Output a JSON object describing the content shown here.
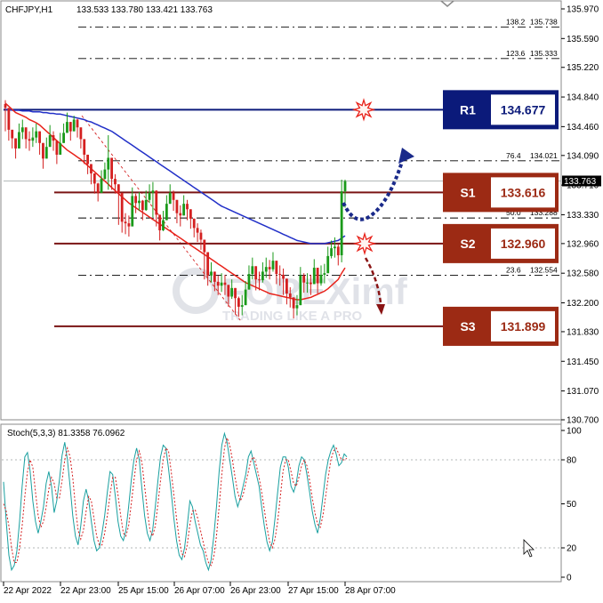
{
  "header": {
    "symbol": "CHFJPY,H1",
    "ohlc": "133.533 133.780 133.421 133.763"
  },
  "watermark": {
    "brand": "FOREXimf",
    "tagline": "TRADING LIKE A PRO"
  },
  "colors": {
    "bull": "#1a9a1a",
    "bear": "#d42020",
    "ma_fast": "#e8221a",
    "ma_slow": "#2230c8",
    "resistance": "#0b1a7a",
    "support": "#7a1414",
    "support_box": "#9c2a14",
    "fib": "#000000",
    "stoch_main": "#1aa0a0",
    "stoch_signal": "#d42020"
  },
  "chart_data": [
    {
      "type": "candlestick",
      "title": "CHFJPY,H1",
      "ylim": [
        130.7,
        135.97
      ],
      "y_ticks": [
        "135.970",
        "135.590",
        "135.220",
        "134.840",
        "134.460",
        "134.090",
        "133.710",
        "133.330",
        "132.960",
        "132.580",
        "132.200",
        "131.830",
        "131.450",
        "131.070",
        "130.700"
      ],
      "current_price": "133.763",
      "x_labels": [
        "22 Apr 2022",
        "22 Apr 23:00",
        "25 Apr 15:00",
        "26 Apr 07:00",
        "26 Apr 23:00",
        "27 Apr 15:00",
        "28 Apr 07:00"
      ],
      "close": [
        134.7,
        134.42,
        134.31,
        134.18,
        134.39,
        134.45,
        134.3,
        134.28,
        134.32,
        134.4,
        134.25,
        134.05,
        134.2,
        134.35,
        134.28,
        134.1,
        134.25,
        134.38,
        134.52,
        134.4,
        134.55,
        134.45,
        134.3,
        134.1,
        133.98,
        133.86,
        133.73,
        133.61,
        133.79,
        133.91,
        134.06,
        133.79,
        133.72,
        133.61,
        133.24,
        133.22,
        133.18,
        133.57,
        133.48,
        133.51,
        133.39,
        133.52,
        133.61,
        133.64,
        133.33,
        133.13,
        133.26,
        133.47,
        133.61,
        133.52,
        133.35,
        133.32,
        133.47,
        133.4,
        133.28,
        133.16,
        133.1,
        133.01,
        132.85,
        132.55,
        132.6,
        132.47,
        132.42,
        132.46,
        132.43,
        132.28,
        132.39,
        132.26,
        132.15,
        132.17,
        132.37,
        132.57,
        132.67,
        132.5,
        132.49,
        132.6,
        132.66,
        132.63,
        132.74,
        132.57,
        132.56,
        132.51,
        132.32,
        132.27,
        132.13,
        132.17,
        132.55,
        132.46,
        132.46,
        132.44,
        132.65,
        132.45,
        132.56,
        132.58,
        132.8,
        132.9,
        132.92,
        132.81,
        133.63,
        133.76
      ],
      "high": [
        134.8,
        134.55,
        134.42,
        134.3,
        134.5,
        134.55,
        134.42,
        134.4,
        134.45,
        134.5,
        134.38,
        134.18,
        134.32,
        134.48,
        134.4,
        134.22,
        134.38,
        134.5,
        134.64,
        134.52,
        134.6,
        134.56,
        134.4,
        134.22,
        134.1,
        133.98,
        133.86,
        133.74,
        133.9,
        134.0,
        134.35,
        133.92,
        133.85,
        133.72,
        133.4,
        133.35,
        133.32,
        133.68,
        133.6,
        133.62,
        133.52,
        133.64,
        133.72,
        133.75,
        133.45,
        133.26,
        133.38,
        133.58,
        133.72,
        133.64,
        133.48,
        133.45,
        133.58,
        133.52,
        133.4,
        133.28,
        133.22,
        133.14,
        132.98,
        132.68,
        132.72,
        132.6,
        132.55,
        132.58,
        132.56,
        132.4,
        132.5,
        132.38,
        132.28,
        132.3,
        132.48,
        132.68,
        132.78,
        132.62,
        132.6,
        132.72,
        132.78,
        132.75,
        132.85,
        132.7,
        132.68,
        132.64,
        132.45,
        132.4,
        132.26,
        132.3,
        132.66,
        132.58,
        132.58,
        132.56,
        132.76,
        132.58,
        132.68,
        132.7,
        132.92,
        133.0,
        133.04,
        132.95,
        133.78,
        133.78
      ],
      "low": [
        134.4,
        134.28,
        134.18,
        134.05,
        134.26,
        134.3,
        134.18,
        134.15,
        134.2,
        134.25,
        134.1,
        133.92,
        134.08,
        134.22,
        134.15,
        133.98,
        134.12,
        134.25,
        134.4,
        134.28,
        134.42,
        134.32,
        134.18,
        133.98,
        133.85,
        133.72,
        133.6,
        133.5,
        133.66,
        133.78,
        133.65,
        133.65,
        133.6,
        133.2,
        133.1,
        133.08,
        133.05,
        133.45,
        133.35,
        133.38,
        133.26,
        133.38,
        133.48,
        133.3,
        133.18,
        133.0,
        133.12,
        133.35,
        133.48,
        133.38,
        133.22,
        133.18,
        133.32,
        133.26,
        133.15,
        133.04,
        132.98,
        132.88,
        132.5,
        132.42,
        132.46,
        132.35,
        132.3,
        132.34,
        132.3,
        132.15,
        132.25,
        132.05,
        132.02,
        132.04,
        132.22,
        132.42,
        132.5,
        132.36,
        132.36,
        132.46,
        132.52,
        132.5,
        132.6,
        132.44,
        132.42,
        132.3,
        132.18,
        132.14,
        132.0,
        132.04,
        132.4,
        132.33,
        132.33,
        132.3,
        132.5,
        132.32,
        132.42,
        132.45,
        132.66,
        132.77,
        132.78,
        132.68,
        132.72,
        133.42
      ],
      "ma_fast": [
        134.76,
        134.72,
        134.68,
        134.64,
        134.62,
        134.6,
        134.58,
        134.55,
        134.53,
        134.51,
        134.48,
        134.44,
        134.4,
        134.36,
        134.32,
        134.28,
        134.24,
        134.2,
        134.16,
        134.13,
        134.1,
        134.07,
        134.04,
        134.0,
        133.96,
        133.92,
        133.88,
        133.84,
        133.8,
        133.76,
        133.72,
        133.68,
        133.64,
        133.6,
        133.56,
        133.52,
        133.48,
        133.45,
        133.42,
        133.39,
        133.36,
        133.33,
        133.3,
        133.27,
        133.24,
        133.21,
        133.18,
        133.15,
        133.12,
        133.09,
        133.06,
        133.03,
        133.0,
        132.97,
        132.94,
        132.91,
        132.88,
        132.85,
        132.82,
        132.79,
        132.76,
        132.73,
        132.7,
        132.67,
        132.64,
        132.61,
        132.58,
        132.55,
        132.52,
        132.49,
        132.46,
        132.44,
        132.42,
        132.4,
        132.38,
        132.36,
        132.34,
        132.32,
        132.31,
        132.3,
        132.29,
        132.28,
        132.27,
        132.26,
        132.25,
        132.24,
        132.24,
        132.25,
        132.26,
        132.27,
        132.29,
        132.31,
        132.33,
        132.35,
        132.38,
        132.42,
        132.46,
        132.5,
        132.58,
        132.65
      ],
      "ma_slow": [
        134.68,
        134.68,
        134.67,
        134.67,
        134.67,
        134.66,
        134.66,
        134.66,
        134.65,
        134.65,
        134.65,
        134.64,
        134.64,
        134.63,
        134.63,
        134.62,
        134.62,
        134.61,
        134.6,
        134.59,
        134.58,
        134.57,
        134.56,
        134.55,
        134.53,
        134.52,
        134.5,
        134.48,
        134.46,
        134.44,
        134.42,
        134.4,
        134.37,
        134.34,
        134.31,
        134.28,
        134.25,
        134.22,
        134.19,
        134.16,
        134.13,
        134.1,
        134.07,
        134.04,
        134.01,
        133.98,
        133.95,
        133.92,
        133.89,
        133.86,
        133.83,
        133.8,
        133.77,
        133.74,
        133.71,
        133.68,
        133.65,
        133.62,
        133.59,
        133.56,
        133.53,
        133.5,
        133.47,
        133.44,
        133.42,
        133.4,
        133.38,
        133.36,
        133.34,
        133.32,
        133.3,
        133.28,
        133.26,
        133.24,
        133.22,
        133.2,
        133.18,
        133.16,
        133.14,
        133.12,
        133.1,
        133.08,
        133.06,
        133.04,
        133.02,
        133.0,
        132.99,
        132.98,
        132.97,
        132.96,
        132.96,
        132.96,
        132.96,
        132.96,
        132.97,
        132.98,
        132.99,
        133.0,
        133.03,
        133.06
      ],
      "levels": [
        {
          "label": "R1",
          "value": "134.677",
          "price": 134.677,
          "kind": "resistance"
        },
        {
          "label": "S1",
          "value": "133.616",
          "price": 133.616,
          "kind": "support"
        },
        {
          "label": "S2",
          "value": "132.960",
          "price": 132.96,
          "kind": "support"
        },
        {
          "label": "S3",
          "value": "131.899",
          "price": 131.899,
          "kind": "support"
        }
      ],
      "fib_levels": [
        {
          "label": "138.2",
          "value": "135.738",
          "price": 135.738
        },
        {
          "label": "123.6",
          "value": "135.333",
          "price": 135.333
        },
        {
          "label": "76.4",
          "value": "134.021",
          "price": 134.021
        },
        {
          "label": "50.0",
          "value": "133.288",
          "price": 133.288
        },
        {
          "label": "23.6",
          "value": "132.554",
          "price": 132.554
        }
      ]
    },
    {
      "type": "line",
      "title": "Stoch(5,3,3) 81.3358 76.0962",
      "ylim": [
        0,
        100
      ],
      "y_ticks": [
        "100",
        "80",
        "50",
        "20",
        "0"
      ],
      "series": [
        {
          "name": "main",
          "values": [
            65,
            38,
            15,
            5,
            8,
            18,
            38,
            62,
            82,
            85,
            72,
            52,
            38,
            30,
            38,
            48,
            64,
            72,
            62,
            44,
            52,
            66,
            83,
            92,
            80,
            62,
            42,
            28,
            22,
            35,
            52,
            60,
            52,
            38,
            25,
            18,
            20,
            30,
            42,
            58,
            72,
            70,
            55,
            38,
            28,
            25,
            32,
            48,
            66,
            80,
            88,
            80,
            60,
            42,
            30,
            25,
            32,
            48,
            66,
            82,
            90,
            88,
            74,
            58,
            40,
            25,
            15,
            12,
            20,
            35,
            52,
            48,
            38,
            30,
            22,
            18,
            10,
            5,
            12,
            28,
            48,
            72,
            90,
            98,
            92,
            80,
            68,
            55,
            48,
            54,
            62,
            70,
            82,
            86,
            78,
            70,
            62,
            48,
            35,
            24,
            18,
            24,
            40,
            58,
            75,
            82,
            82,
            75,
            62,
            58,
            64,
            76,
            82,
            80,
            70,
            58,
            45,
            36,
            30,
            40,
            55,
            70,
            80,
            86,
            90,
            84,
            76,
            78,
            84,
            82
          ]
        },
        {
          "name": "signal",
          "values": [
            50,
            45,
            35,
            20,
            10,
            10,
            20,
            35,
            55,
            72,
            80,
            75,
            58,
            42,
            34,
            38,
            48,
            60,
            68,
            64,
            54,
            54,
            66,
            80,
            88,
            82,
            68,
            48,
            32,
            26,
            32,
            45,
            55,
            52,
            40,
            28,
            22,
            22,
            30,
            42,
            56,
            68,
            68,
            56,
            42,
            30,
            28,
            35,
            50,
            66,
            80,
            86,
            78,
            62,
            46,
            32,
            28,
            35,
            50,
            66,
            80,
            88,
            86,
            72,
            56,
            40,
            26,
            16,
            14,
            22,
            36,
            45,
            46,
            40,
            32,
            24,
            16,
            10,
            8,
            14,
            28,
            48,
            70,
            88,
            95,
            90,
            80,
            68,
            58,
            52,
            56,
            64,
            72,
            80,
            82,
            76,
            68,
            58,
            46,
            34,
            24,
            20,
            26,
            38,
            55,
            72,
            80,
            80,
            72,
            64,
            62,
            68,
            76,
            80,
            76,
            66,
            54,
            44,
            36,
            34,
            42,
            55,
            68,
            80,
            86,
            88,
            84,
            80,
            80,
            81
          ]
        }
      ]
    }
  ]
}
